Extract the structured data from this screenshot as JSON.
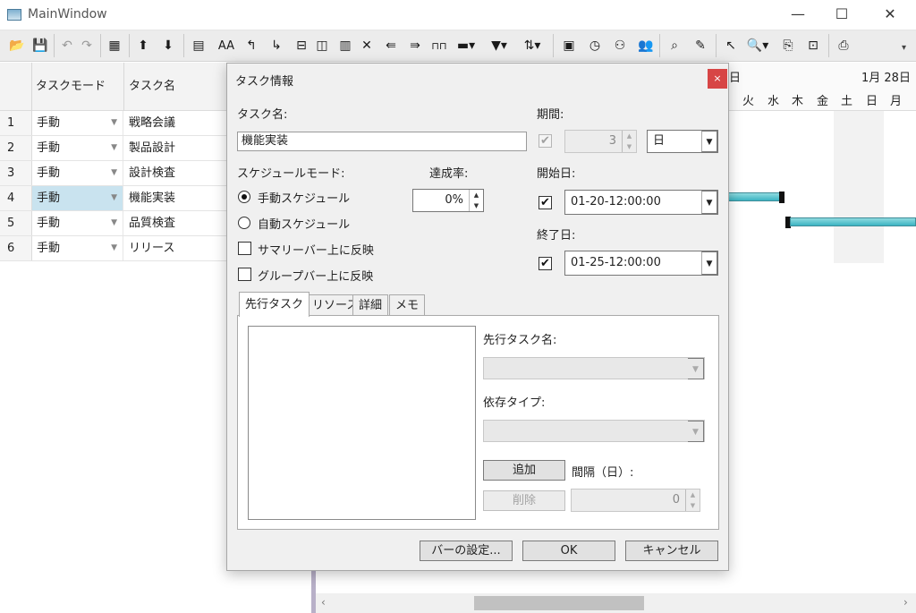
{
  "window": {
    "title": "MainWindow",
    "minimize": "—",
    "maximize": "☐",
    "close": "✕"
  },
  "toolbar": {
    "icons": [
      "open-icon",
      "save-icon",
      "undo-icon",
      "redo-icon",
      "grid-icon",
      "move-up-icon",
      "move-down-icon",
      "task-info-icon",
      "font-icon",
      "outdent-icon",
      "indent-icon",
      "link-icon",
      "split-icon",
      "calendar-icon",
      "delete-icon",
      "insert-above-icon",
      "insert-below-icon",
      "milestone-icon",
      "summary-icon",
      "filter-icon",
      "sort-icon",
      "report-icon",
      "schedule-icon",
      "resource-icon",
      "users-icon",
      "find-icon",
      "highlight-icon",
      "pointer-icon",
      "zoom-icon",
      "export-icon",
      "preview-icon",
      "print-icon"
    ],
    "font_label": "AA"
  },
  "grid": {
    "headers": {
      "mode": "タスクモード",
      "name": "タスク名"
    },
    "rows": [
      {
        "num": "1",
        "mode": "手動",
        "name": "戦略会議"
      },
      {
        "num": "2",
        "mode": "手動",
        "name": "製品設計"
      },
      {
        "num": "3",
        "mode": "手動",
        "name": "設計検査"
      },
      {
        "num": "4",
        "mode": "手動",
        "name": "機能実装"
      },
      {
        "num": "5",
        "mode": "手動",
        "name": "品質検査"
      },
      {
        "num": "6",
        "mode": "手動",
        "name": "リリース"
      }
    ]
  },
  "gantt": {
    "header_partial": "日",
    "date": "1月 28日",
    "days": [
      "火",
      "水",
      "木",
      "金",
      "土",
      "日",
      "月"
    ]
  },
  "dialog": {
    "title": "タスク情報",
    "close": "×",
    "task_name_label": "タスク名:",
    "task_name_value": "機能実装",
    "schedule_mode_label": "スケジュールモード:",
    "manual_schedule": "手動スケジュール",
    "auto_schedule": "自動スケジュール",
    "summary_bar": "サマリーバー上に反映",
    "group_bar": "グループバー上に反映",
    "progress_label": "達成率:",
    "progress_value": "0%",
    "duration_label": "期間:",
    "duration_value": "3",
    "duration_unit": "日",
    "start_label": "開始日:",
    "start_value": "01-20-12:00:00",
    "end_label": "終了日:",
    "end_value": "01-25-12:00:00",
    "tabs": [
      "先行タスク",
      "リソース",
      "詳細",
      "メモ"
    ],
    "predecessor_name_label": "先行タスク名:",
    "dependency_type_label": "依存タイプ:",
    "add_button": "追加",
    "delete_button": "削除",
    "interval_label": "間隔（日）:",
    "interval_value": "0",
    "bar_settings_button": "バーの設定...",
    "ok_button": "OK",
    "cancel_button": "キャンセル"
  }
}
